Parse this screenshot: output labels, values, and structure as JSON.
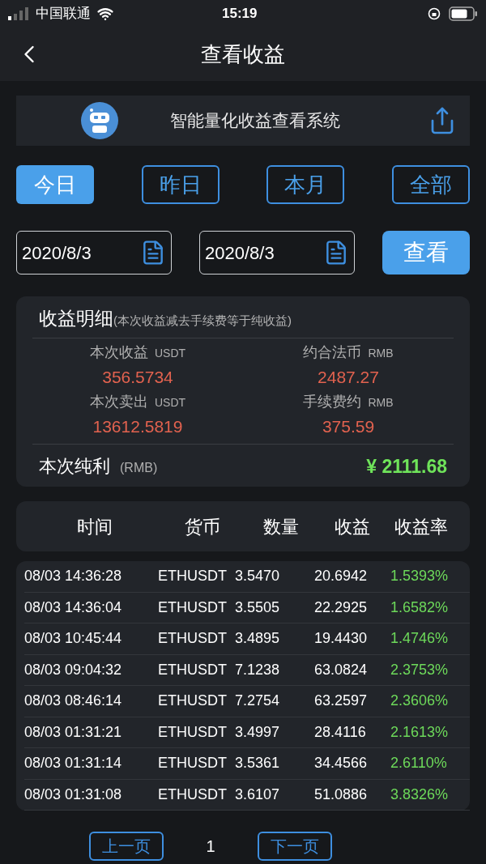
{
  "status_bar": {
    "carrier": "中国联通",
    "time": "15:19"
  },
  "nav": {
    "title": "查看收益"
  },
  "banner": {
    "title": "智能量化收益查看系统"
  },
  "tabs": [
    {
      "label": "今日",
      "selected": true
    },
    {
      "label": "昨日",
      "selected": false
    },
    {
      "label": "本月",
      "selected": false
    },
    {
      "label": "全部",
      "selected": false
    }
  ],
  "date_range": {
    "start": "2020/8/3",
    "end": "2020/8/3",
    "button": "查看"
  },
  "summary": {
    "title": "收益明细",
    "note": "(本次收益减去手续费等于纯收益)",
    "items": [
      {
        "label": "本次收益",
        "unit": "USDT",
        "value": "356.5734"
      },
      {
        "label": "约合法币",
        "unit": "RMB",
        "value": "2487.27"
      },
      {
        "label": "本次卖出",
        "unit": "USDT",
        "value": "13612.5819"
      },
      {
        "label": "手续费约",
        "unit": "RMB",
        "value": "375.59"
      }
    ],
    "net": {
      "label": "本次纯利",
      "unit": "(RMB)",
      "value": "¥ 2111.68"
    }
  },
  "table": {
    "columns": [
      "时间",
      "货币",
      "数量",
      "收益",
      "收益率"
    ],
    "rows": [
      [
        "08/03 14:36:28",
        "ETHUSDT",
        "3.5470",
        "20.6942",
        "1.5393%"
      ],
      [
        "08/03 14:36:04",
        "ETHUSDT",
        "3.5505",
        "22.2925",
        "1.6582%"
      ],
      [
        "08/03 10:45:44",
        "ETHUSDT",
        "3.4895",
        "19.4430",
        "1.4746%"
      ],
      [
        "08/03 09:04:32",
        "ETHUSDT",
        "7.1238",
        "63.0824",
        "2.3753%"
      ],
      [
        "08/03 08:46:14",
        "ETHUSDT",
        "7.2754",
        "63.2597",
        "2.3606%"
      ],
      [
        "08/03 01:31:21",
        "ETHUSDT",
        "3.4997",
        "28.4116",
        "2.1613%"
      ],
      [
        "08/03 01:31:14",
        "ETHUSDT",
        "3.5361",
        "34.4566",
        "2.6110%"
      ],
      [
        "08/03 01:31:08",
        "ETHUSDT",
        "3.6107",
        "51.0886",
        "3.8326%"
      ]
    ]
  },
  "pagination": {
    "prev": "上一页",
    "page": "1",
    "next": "下一页"
  }
}
